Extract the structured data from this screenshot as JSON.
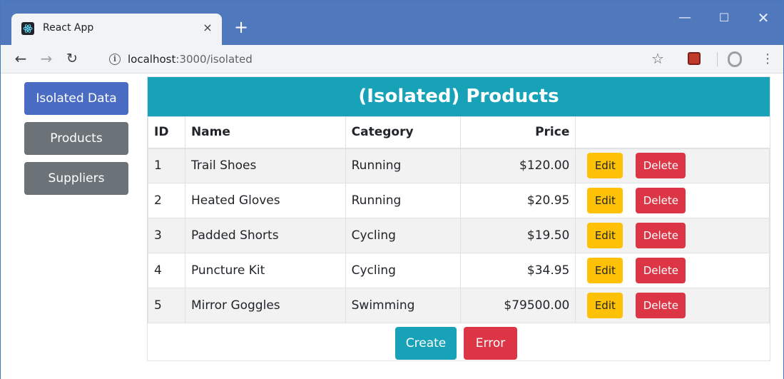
{
  "browser": {
    "tab_title": "React App",
    "tab_close": "×",
    "new_tab": "+",
    "window_controls": {
      "minimize": "—",
      "maximize": "☐",
      "close": "✕"
    },
    "url_host": "localhost",
    "url_path": ":3000/isolated"
  },
  "sidebar": {
    "items": [
      {
        "label": "Isolated Data",
        "active": true
      },
      {
        "label": "Products",
        "active": false
      },
      {
        "label": "Suppliers",
        "active": false
      }
    ]
  },
  "table": {
    "title": "(Isolated) Products",
    "headers": {
      "id": "ID",
      "name": "Name",
      "category": "Category",
      "price": "Price"
    },
    "rows": [
      {
        "id": "1",
        "name": "Trail Shoes",
        "category": "Running",
        "price": "$120.00"
      },
      {
        "id": "2",
        "name": "Heated Gloves",
        "category": "Running",
        "price": "$20.95"
      },
      {
        "id": "3",
        "name": "Padded Shorts",
        "category": "Cycling",
        "price": "$19.50"
      },
      {
        "id": "4",
        "name": "Puncture Kit",
        "category": "Cycling",
        "price": "$34.95"
      },
      {
        "id": "5",
        "name": "Mirror Goggles",
        "category": "Swimming",
        "price": "$79500.00"
      }
    ],
    "edit_label": "Edit",
    "delete_label": "Delete",
    "create_label": "Create",
    "error_label": "Error"
  },
  "colors": {
    "titlebar": "#5078bd",
    "primary": "#4a6dc3",
    "secondary": "#6b7378",
    "info": "#17a2b8",
    "warning": "#ffc107",
    "danger": "#dc3545"
  }
}
